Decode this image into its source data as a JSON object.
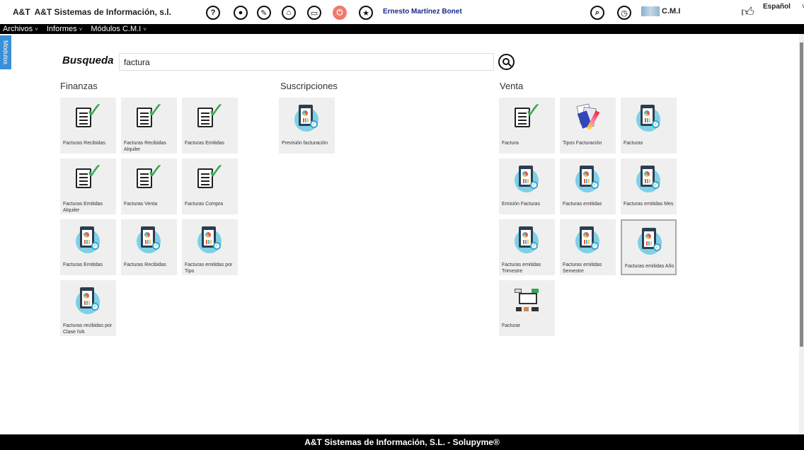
{
  "header": {
    "logo": "A&T",
    "company": "A&T Sistemas de Información, s.l.",
    "user": "Ernesto Martínez Bonet",
    "cmi_label": "C.M.I",
    "language": "Español"
  },
  "toolbar_icons": [
    "help-icon",
    "record-icon",
    "magic-wand-icon",
    "home-icon",
    "folder-icon",
    "power-icon",
    "favorites-star-icon"
  ],
  "menu": [
    {
      "label": "Archivos"
    },
    {
      "label": "Informes"
    },
    {
      "label": "Módulos C.M.I"
    }
  ],
  "side_tab": "Módulos",
  "search": {
    "label": "Busqueda",
    "value": "factura"
  },
  "sections": {
    "finanzas": {
      "title": "Finanzas",
      "tiles": [
        {
          "label": "Facturas Recibidas",
          "icon": "checklist"
        },
        {
          "label": "Facturas Recibidas Alquiler",
          "icon": "checklist"
        },
        {
          "label": "Facturas Emitidas",
          "icon": "checklist"
        },
        {
          "label": "Facturas Emitidas Alquiler",
          "icon": "checklist"
        },
        {
          "label": "Facturas Venta",
          "icon": "checklist"
        },
        {
          "label": "Facturas Compra",
          "icon": "checklist"
        },
        {
          "label": "Facturas Emitidas",
          "icon": "clipboard-chart"
        },
        {
          "label": "Facturas Recibidas",
          "icon": "clipboard-chart"
        },
        {
          "label": "Facturas emitidas por Tipo",
          "icon": "clipboard-chart"
        },
        {
          "label": "Facturas recibidas por Clase IVA",
          "icon": "clipboard-chart"
        }
      ]
    },
    "suscripciones": {
      "title": "Suscripciones",
      "tiles": [
        {
          "label": "Previsión facturación",
          "icon": "clipboard-chart"
        }
      ]
    },
    "venta": {
      "title": "Venta",
      "tiles": [
        {
          "label": "Factura",
          "icon": "checklist"
        },
        {
          "label": "Tipos Facturación",
          "icon": "documents"
        },
        {
          "label": "Facturas",
          "icon": "clipboard-chart"
        },
        {
          "label": "Emisión Facturas",
          "icon": "clipboard-chart"
        },
        {
          "label": "Facturas emitidas",
          "icon": "clipboard-chart"
        },
        {
          "label": "Facturas emitidas Mes",
          "icon": "clipboard-chart"
        },
        {
          "label": "Facturas emitidas Trimestre",
          "icon": "clipboard-chart"
        },
        {
          "label": "Facturas emitidas Semestre",
          "icon": "clipboard-chart"
        },
        {
          "label": "Facturas emitidas Año",
          "icon": "clipboard-chart"
        },
        {
          "label": "Facturar",
          "icon": "workflow"
        }
      ]
    }
  },
  "footer": "A&T Sistemas de Información, S.L. - Solupyme®"
}
